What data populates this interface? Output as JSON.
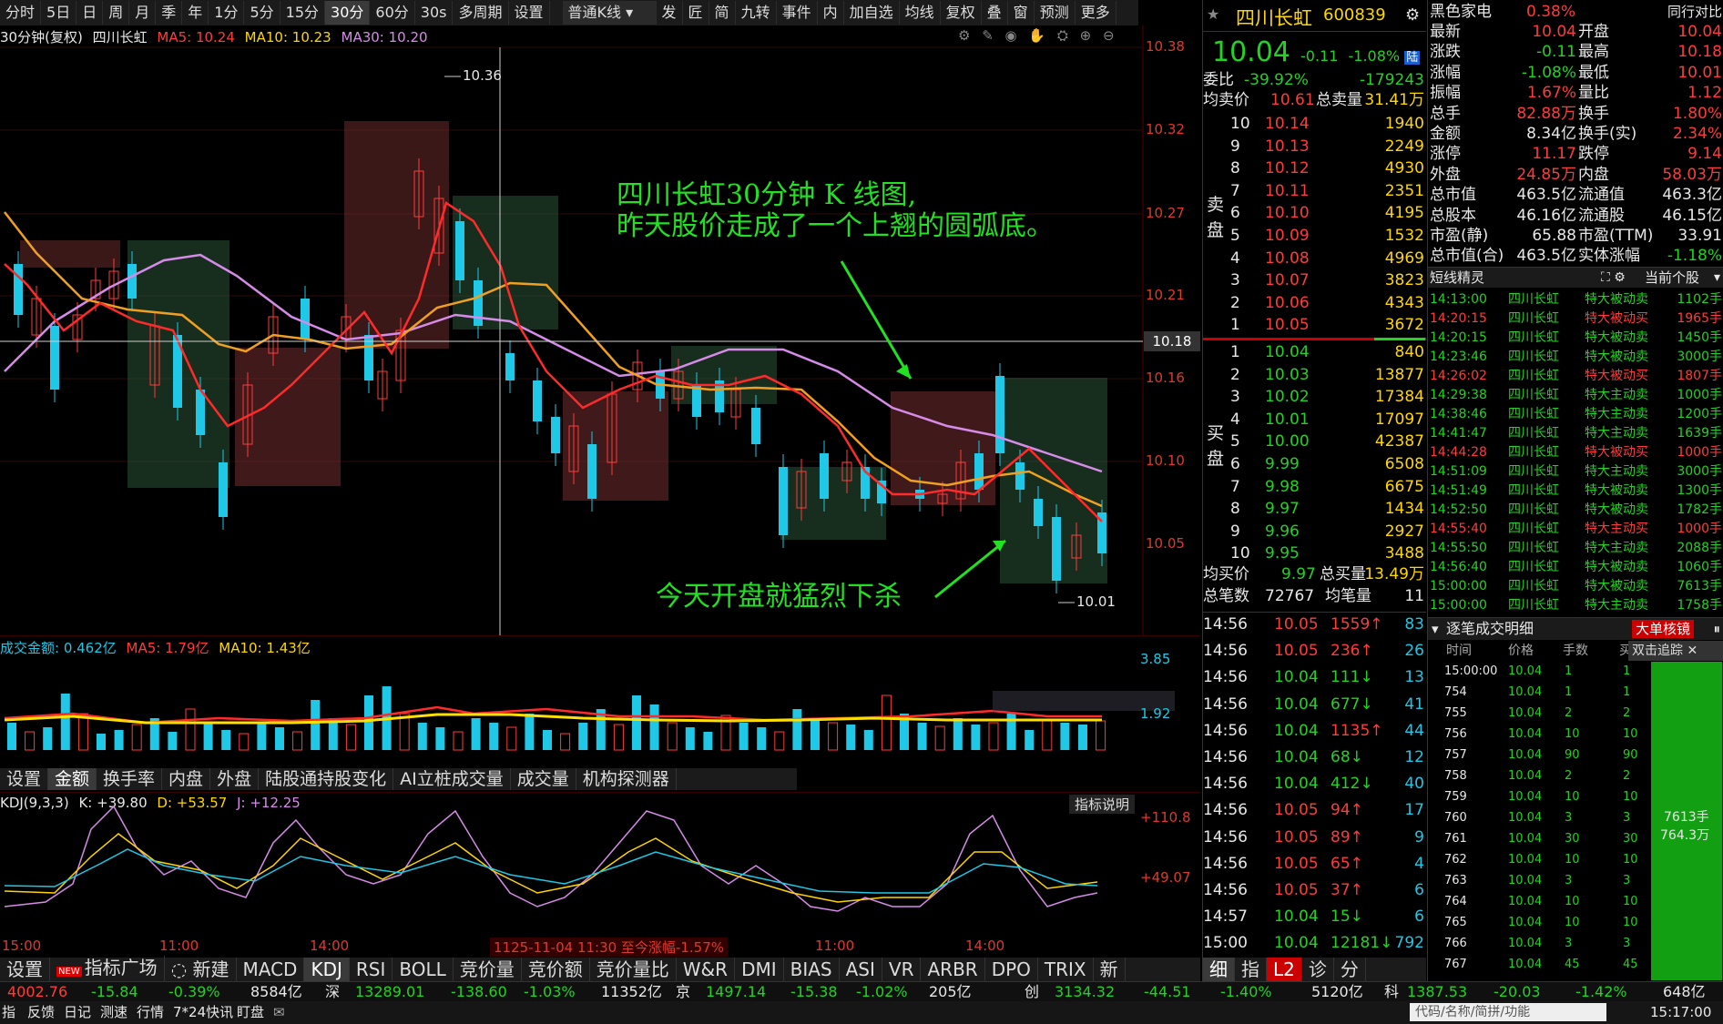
{
  "toolbar": {
    "items": [
      "分时",
      "5日",
      "日",
      "周",
      "月",
      "季",
      "年",
      "1分",
      "5分",
      "15分",
      "30分",
      "60分",
      "30s",
      "多周期",
      "设置"
    ],
    "active": "30分",
    "mode": "普通K线",
    "right_items": [
      "发",
      "匠",
      "简",
      "九转",
      "事件",
      "内",
      "加自选",
      "均线",
      "复权",
      "叠",
      "窗",
      "预测",
      "更多"
    ]
  },
  "chart_header": {
    "title": "30分钟(复权)",
    "name": "四川长虹",
    "ma5": "MA5: 10.24",
    "ma10": "MA10: 10.23",
    "ma30": "MA30: 10.20"
  },
  "price_axis": [
    "10.38",
    "10.32",
    "10.27",
    "10.21",
    "10.16",
    "10.10",
    "10.05"
  ],
  "crosshair_price": "10.18",
  "markers": {
    "high": "10.36",
    "low": "10.01"
  },
  "annotations": {
    "line1": "四川长虹30分钟 K 线图,",
    "line2": "昨天股价走成了一个上翘的圆弧底。",
    "line3": "今天开盘就猛烈下杀"
  },
  "volume_header": {
    "label": "成交金额: 0.462亿",
    "ma5": "MA5: 1.79亿",
    "ma10": "MA10: 1.43亿"
  },
  "volume_axis": [
    "3.85",
    "1.92"
  ],
  "volume_tabs": [
    "设置",
    "金额",
    "换手率",
    "内盘",
    "外盘",
    "陆股通持股变化",
    "AI立桩成交量",
    "成交量",
    "机构探测器"
  ],
  "volume_active": "金额",
  "kdj_header": {
    "label": "KDJ(9,3,3)",
    "k": "K: +39.80",
    "d": "D: +53.57",
    "j": "J: +12.25",
    "help": "指标说明"
  },
  "kdj_axis": [
    "+110.8",
    "+49.07"
  ],
  "time_axis": [
    "15:00",
    "11:00",
    "14:00",
    "1125-11-04 11:30 至今涨幅-1.57%",
    "11:00",
    "14:00"
  ],
  "indicator_tabs": [
    "设置",
    "指标广场",
    "新建",
    "MACD",
    "KDJ",
    "RSI",
    "BOLL",
    "竞价量",
    "竞价额",
    "竞价量比",
    "W&R",
    "DMI",
    "BIAS",
    "ASI",
    "VR",
    "ARBR",
    "DPO",
    "TRIX",
    "新"
  ],
  "indicator_active": "KDJ",
  "quote": {
    "name": "四川长虹",
    "code": "600839",
    "price": "10.04",
    "change": "-0.11",
    "pct": "-1.08%",
    "tag": "陆",
    "weibi": "-39.92%",
    "weicha": "-179243",
    "avg_sell": "10.61",
    "total_sell": "31.41万",
    "avg_buy": "9.97",
    "total_buy": "13.49万",
    "total_trades": "72767",
    "avg_trade_label": "均笔量",
    "avg_trade": "11"
  },
  "sells": [
    [
      "10",
      "10.14",
      "1940"
    ],
    [
      "9",
      "10.13",
      "2249"
    ],
    [
      "8",
      "10.12",
      "4930"
    ],
    [
      "7",
      "10.11",
      "2351"
    ],
    [
      "6",
      "10.10",
      "4195"
    ],
    [
      "5",
      "10.09",
      "1532"
    ],
    [
      "4",
      "10.08",
      "4969"
    ],
    [
      "3",
      "10.07",
      "3823"
    ],
    [
      "2",
      "10.06",
      "4343"
    ],
    [
      "1",
      "10.05",
      "3672"
    ]
  ],
  "buys": [
    [
      "1",
      "10.04",
      "840"
    ],
    [
      "2",
      "10.03",
      "13877"
    ],
    [
      "3",
      "10.02",
      "17384"
    ],
    [
      "4",
      "10.01",
      "17097"
    ],
    [
      "5",
      "10.00",
      "42387"
    ],
    [
      "6",
      "9.99",
      "6508"
    ],
    [
      "7",
      "9.98",
      "6675"
    ],
    [
      "8",
      "9.97",
      "1434"
    ],
    [
      "9",
      "9.96",
      "2927"
    ],
    [
      "10",
      "9.95",
      "3488"
    ]
  ],
  "ticks": [
    [
      "14:56",
      "10.05",
      "1559",
      "up",
      "83"
    ],
    [
      "14:56",
      "10.05",
      "236",
      "up",
      "26"
    ],
    [
      "14:56",
      "10.04",
      "111",
      "dn",
      "13"
    ],
    [
      "14:56",
      "10.04",
      "677",
      "dn",
      "41"
    ],
    [
      "14:56",
      "10.04",
      "1135",
      "up",
      "44"
    ],
    [
      "14:56",
      "10.04",
      "68",
      "dn",
      "12"
    ],
    [
      "14:56",
      "10.04",
      "412",
      "dn",
      "40"
    ],
    [
      "14:56",
      "10.05",
      "94",
      "up",
      "17"
    ],
    [
      "14:56",
      "10.05",
      "89",
      "up",
      "9"
    ],
    [
      "14:56",
      "10.05",
      "65",
      "up",
      "4"
    ],
    [
      "14:56",
      "10.05",
      "37",
      "up",
      "6"
    ],
    [
      "14:57",
      "10.04",
      "15",
      "dn",
      "6"
    ],
    [
      "15:00",
      "10.04",
      "12181",
      "dn",
      "792"
    ]
  ],
  "right1_tabs": [
    "细",
    "指",
    "L2",
    "诊",
    "分"
  ],
  "stats": {
    "sector": "黑色家电",
    "sector_pct": "0.38%",
    "peer": "同行对比",
    "rows": [
      [
        "最新",
        "10.04",
        "开盘",
        "10.04"
      ],
      [
        "涨跌",
        "-0.11",
        "最高",
        "10.18"
      ],
      [
        "涨幅",
        "-1.08%",
        "最低",
        "10.01"
      ],
      [
        "振幅",
        "1.67%",
        "量比",
        "1.12"
      ],
      [
        "总手",
        "82.88万",
        "换手",
        "1.80%"
      ],
      [
        "金额",
        "8.34亿",
        "换手(实)",
        "2.34%"
      ],
      [
        "涨停",
        "11.17",
        "跌停",
        "9.14"
      ],
      [
        "外盘",
        "24.85万",
        "内盘",
        "58.03万"
      ],
      [
        "总市值",
        "463.5亿",
        "流通值",
        "463.3亿"
      ],
      [
        "总股本",
        "46.16亿",
        "流通股",
        "46.15亿"
      ],
      [
        "市盈(静)",
        "65.88",
        "市盈(TTM)",
        "33.91"
      ],
      [
        "总市值(合)",
        "463.5亿",
        "实体涨幅",
        "-1.18%"
      ]
    ]
  },
  "short_line": {
    "title": "短线精灵",
    "filter": "当前个股",
    "rows": [
      [
        "14:13:00",
        "四川长虹",
        "特大被动卖",
        "1102手",
        "g"
      ],
      [
        "14:20:15",
        "四川长虹",
        "特大被动买",
        "1965手",
        "r"
      ],
      [
        "14:20:15",
        "四川长虹",
        "特大被动卖",
        "1450手",
        "g"
      ],
      [
        "14:23:46",
        "四川长虹",
        "特大被动卖",
        "3000手",
        "g"
      ],
      [
        "14:26:02",
        "四川长虹",
        "特大被动买",
        "1807手",
        "r"
      ],
      [
        "14:29:38",
        "四川长虹",
        "特大主动卖",
        "1000手",
        "g"
      ],
      [
        "14:38:46",
        "四川长虹",
        "特大主动卖",
        "1200手",
        "g"
      ],
      [
        "14:41:47",
        "四川长虹",
        "特大主动卖",
        "1639手",
        "g"
      ],
      [
        "14:44:28",
        "四川长虹",
        "特大被动买",
        "1000手",
        "r"
      ],
      [
        "14:51:09",
        "四川长虹",
        "特大主动卖",
        "3000手",
        "g"
      ],
      [
        "14:51:49",
        "四川长虹",
        "特大被动卖",
        "1300手",
        "g"
      ],
      [
        "14:52:50",
        "四川长虹",
        "特大被动卖",
        "1782手",
        "g"
      ],
      [
        "14:55:40",
        "四川长虹",
        "特大主动买",
        "1000手",
        "r"
      ],
      [
        "14:55:50",
        "四川长虹",
        "特大主动卖",
        "2088手",
        "g"
      ],
      [
        "14:56:40",
        "四川长虹",
        "特大被动卖",
        "1060手",
        "g"
      ],
      [
        "15:00:00",
        "四川长虹",
        "特大被动卖",
        "7613手",
        "g"
      ],
      [
        "15:00:00",
        "四川长虹",
        "特大主动卖",
        "1758手",
        "g"
      ]
    ]
  },
  "detail": {
    "title": "逐笔成交明细",
    "btn": "大单核镜",
    "cols": [
      "时间",
      "价格",
      "手数",
      "买"
    ],
    "popup": "双击追踪",
    "rows": [
      [
        "15:00:00",
        "10.04",
        "1",
        "1"
      ],
      [
        "754",
        "10.04",
        "1",
        "1"
      ],
      [
        "755",
        "10.04",
        "2",
        "2"
      ],
      [
        "756",
        "10.04",
        "10",
        "10"
      ],
      [
        "757",
        "10.04",
        "90",
        "90"
      ],
      [
        "758",
        "10.04",
        "2",
        "2"
      ],
      [
        "759",
        "10.04",
        "10",
        "10"
      ],
      [
        "760",
        "10.04",
        "3",
        "3"
      ],
      [
        "761",
        "10.04",
        "30",
        "30"
      ],
      [
        "762",
        "10.04",
        "10",
        "10"
      ],
      [
        "763",
        "10.04",
        "3",
        "3"
      ],
      [
        "764",
        "10.04",
        "10",
        "10"
      ],
      [
        "765",
        "10.04",
        "10",
        "10"
      ],
      [
        "766",
        "10.04",
        "3",
        "3"
      ],
      [
        "767",
        "10.04",
        "45",
        "45"
      ]
    ],
    "green_label1": "7613手",
    "green_label2": "764.3万"
  },
  "status_bar": [
    "4002.76",
    "-15.84",
    "-0.39%",
    "8584亿",
    "深",
    "13289.01",
    "-138.60",
    "-1.03%",
    "11352亿",
    "京",
    "1497.14",
    "-15.38",
    "-1.02%",
    "205亿",
    "创",
    "3134.32",
    "-44.51",
    "-1.40%",
    "5120亿",
    "科",
    "1387.53",
    "-20.03",
    "-1.42%",
    "648亿"
  ],
  "bottom_bar": {
    "items": [
      "指",
      "反馈",
      "日记",
      "测速",
      "行情",
      "7*24快讯",
      "盯盘"
    ],
    "search": "代码/名称/简拼/功能",
    "time": "15:17:00"
  }
}
